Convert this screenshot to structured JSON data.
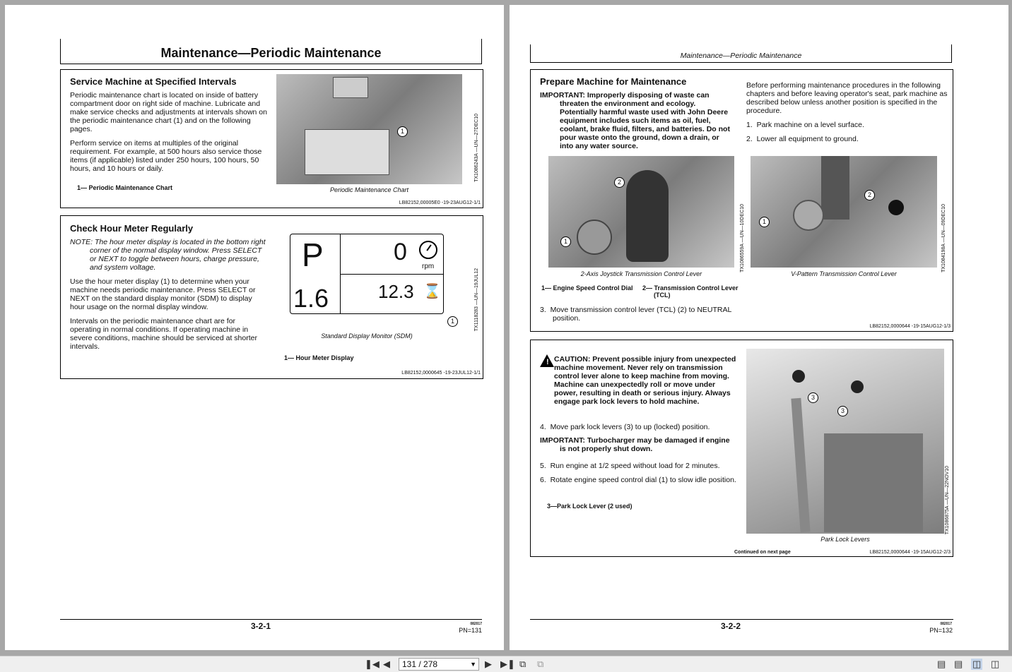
{
  "left_page": {
    "header_title": "Maintenance—Periodic Maintenance",
    "section1": {
      "title": "Service Machine at Specified Intervals",
      "p1": "Periodic maintenance chart is located on inside of battery compartment door on right side of machine. Lubricate and make service checks and adjustments at intervals shown on the periodic maintenance chart (1) and on the following pages.",
      "p2": "Perform service on items at multiples of the original requirement. For example, at 500 hours also service those items (if applicable) listed under 250 hours, 100 hours, 50 hours, and 10 hours or daily.",
      "legend": "1— Periodic Maintenance Chart",
      "caption": "Periodic Maintenance Chart",
      "img_id": "TX1086243A —UN—27DEC10",
      "callout": "1",
      "ref": "LB82152,00005E0 -19-23AUG12-1/1"
    },
    "section2": {
      "title": "Check Hour Meter Regularly",
      "note": "NOTE: The hour meter display is located in the bottom right corner of the normal display window. Press SELECT or NEXT to toggle between hours, charge pressure, and system voltage.",
      "p1": "Use the hour meter display (1) to determine when your machine needs periodic maintenance. Press SELECT or NEXT on the standard display monitor (SDM) to display hour usage on the normal display window.",
      "p2": "Intervals on the periodic maintenance chart are for operating in normal conditions. If operating machine in severe conditions, machine should be serviced at shorter intervals.",
      "sdm": {
        "gear": "P",
        "speed": "0",
        "unit": "rpm",
        "left_value": "1.6",
        "hours": "12.3"
      },
      "callout": "1",
      "caption": "Standard Display Monitor (SDM)",
      "legend": "1— Hour Meter Display",
      "img_id": "TX1118283 —UN—19JUL12",
      "ref": "LB82152,0000645 -19-23JUL12-1/1"
    },
    "footer": {
      "page_num": "3-2-1",
      "code": "082017",
      "pn": "PN=131"
    }
  },
  "right_page": {
    "header_title": "Maintenance—Periodic Maintenance",
    "section1": {
      "title": "Prepare Machine for Maintenance",
      "important": "IMPORTANT: Improperly disposing of waste can threaten the environment and ecology. Potentially harmful waste used with John Deere equipment includes such items as oil, fuel, coolant, brake fluid, filters, and batteries. Do not pour waste onto the ground, down a drain, or into any water source.",
      "intro": "Before performing maintenance procedures in the following chapters and before leaving operator's seat, park machine as described below unless another position is specified in the procedure.",
      "step1": "1.  Park machine on a level surface.",
      "step2": "2.  Lower all equipment to ground.",
      "img1_caption": "2-Axis Joystick Transmission Control Lever",
      "img1_id": "TX1086559A —UN—10DEC10",
      "img2_caption": "V-Pattern Transmission Control Lever",
      "img2_id": "TX1084198A —UN—09DEC10",
      "callout1": "1",
      "callout2": "2",
      "legend1": "1— Engine Speed Control Dial",
      "legend2": "2— Transmission Control Lever (TCL)",
      "step3": "3.  Move transmission control lever (TCL) (2) to NEUTRAL position.",
      "ref": "LB82152,0000644 -19-15AUG12-1/3"
    },
    "section2": {
      "caution": "CAUTION: Prevent possible injury from unexpected machine movement. Never rely on transmission control lever alone to keep machine from moving. Machine can unexpectedly roll or move under power, resulting in death or serious injury. Always engage park lock levers to hold machine.",
      "step4": "4.  Move park lock levers (3) to up (locked) position.",
      "important": "IMPORTANT: Turbocharger may be damaged if engine is not properly shut down.",
      "step5": "5.  Run engine at 1/2 speed without load for 2 minutes.",
      "step6": "6.  Rotate engine speed control dial (1) to slow idle position.",
      "legend": "3—Park Lock Lever (2 used)",
      "caption": "Park Lock Levers",
      "img_id": "TX1086875A —UN—22NOV10",
      "callout": "3",
      "continued": "Continued on next page",
      "ref": "LB82152,0000644 -19-15AUG12-2/3"
    },
    "footer": {
      "page_num": "3-2-2",
      "code": "082017",
      "pn": "PN=132"
    }
  },
  "toolbar": {
    "page_value": "131 / 278",
    "first_icon": "first-page-icon",
    "prev_icon": "prev-page-icon",
    "next_icon": "next-page-icon",
    "last_icon": "last-page-icon"
  }
}
